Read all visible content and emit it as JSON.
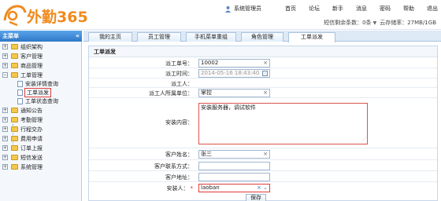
{
  "header": {
    "logo_text": "外勤365",
    "admin_label": "系统管理员",
    "nav": [
      "首页",
      "论坛",
      "新手",
      "消息",
      "密码",
      "帮助",
      "退出"
    ],
    "sms_label": "短信剩余条数：0条",
    "storage_label": "云存储率：27MB/1GB"
  },
  "sidebar": {
    "title": "主菜单",
    "collapse_glyph": "«",
    "items": [
      {
        "label": "组织架构",
        "toggle": "+"
      },
      {
        "label": "客户管理",
        "toggle": "+"
      },
      {
        "label": "商品管理",
        "toggle": "+"
      },
      {
        "label": "工单管理",
        "toggle": "−"
      },
      {
        "label": "安装详情查询"
      },
      {
        "label": "工单派发"
      },
      {
        "label": "工单状态查询"
      },
      {
        "label": "通知公告",
        "toggle": "+"
      },
      {
        "label": "考勤管理",
        "toggle": "+"
      },
      {
        "label": "行程交办",
        "toggle": "+"
      },
      {
        "label": "费用申请",
        "toggle": "+"
      },
      {
        "label": "订单上报",
        "toggle": "+"
      },
      {
        "label": "短信发送",
        "toggle": "+"
      },
      {
        "label": "系统管理",
        "toggle": "+"
      }
    ]
  },
  "tabs": [
    "我的主页",
    "员工管理",
    "手机菜单重组",
    "角色管理",
    "工单派发"
  ],
  "form": {
    "title": "工单派发",
    "order_no_label": "派工单号：",
    "order_no_value": "10002",
    "time_label": "派工时间：",
    "time_value": "2014-05-16 18:43:40",
    "dispatcher_label": "派工人：",
    "dept_label": "派工人所属单位：",
    "dept_value": "掌控",
    "content_label": "安装内容：",
    "content_value": "安装服务器，调试软件",
    "customer_label": "客户姓名：",
    "customer_value": "张三",
    "contact_label": "客户联系方式：",
    "address_label": "客户地址：",
    "installer_label": "安装人：",
    "installer_required": "*",
    "installer_value": "laoban",
    "clear_glyph": "×",
    "save_label": "保存"
  }
}
